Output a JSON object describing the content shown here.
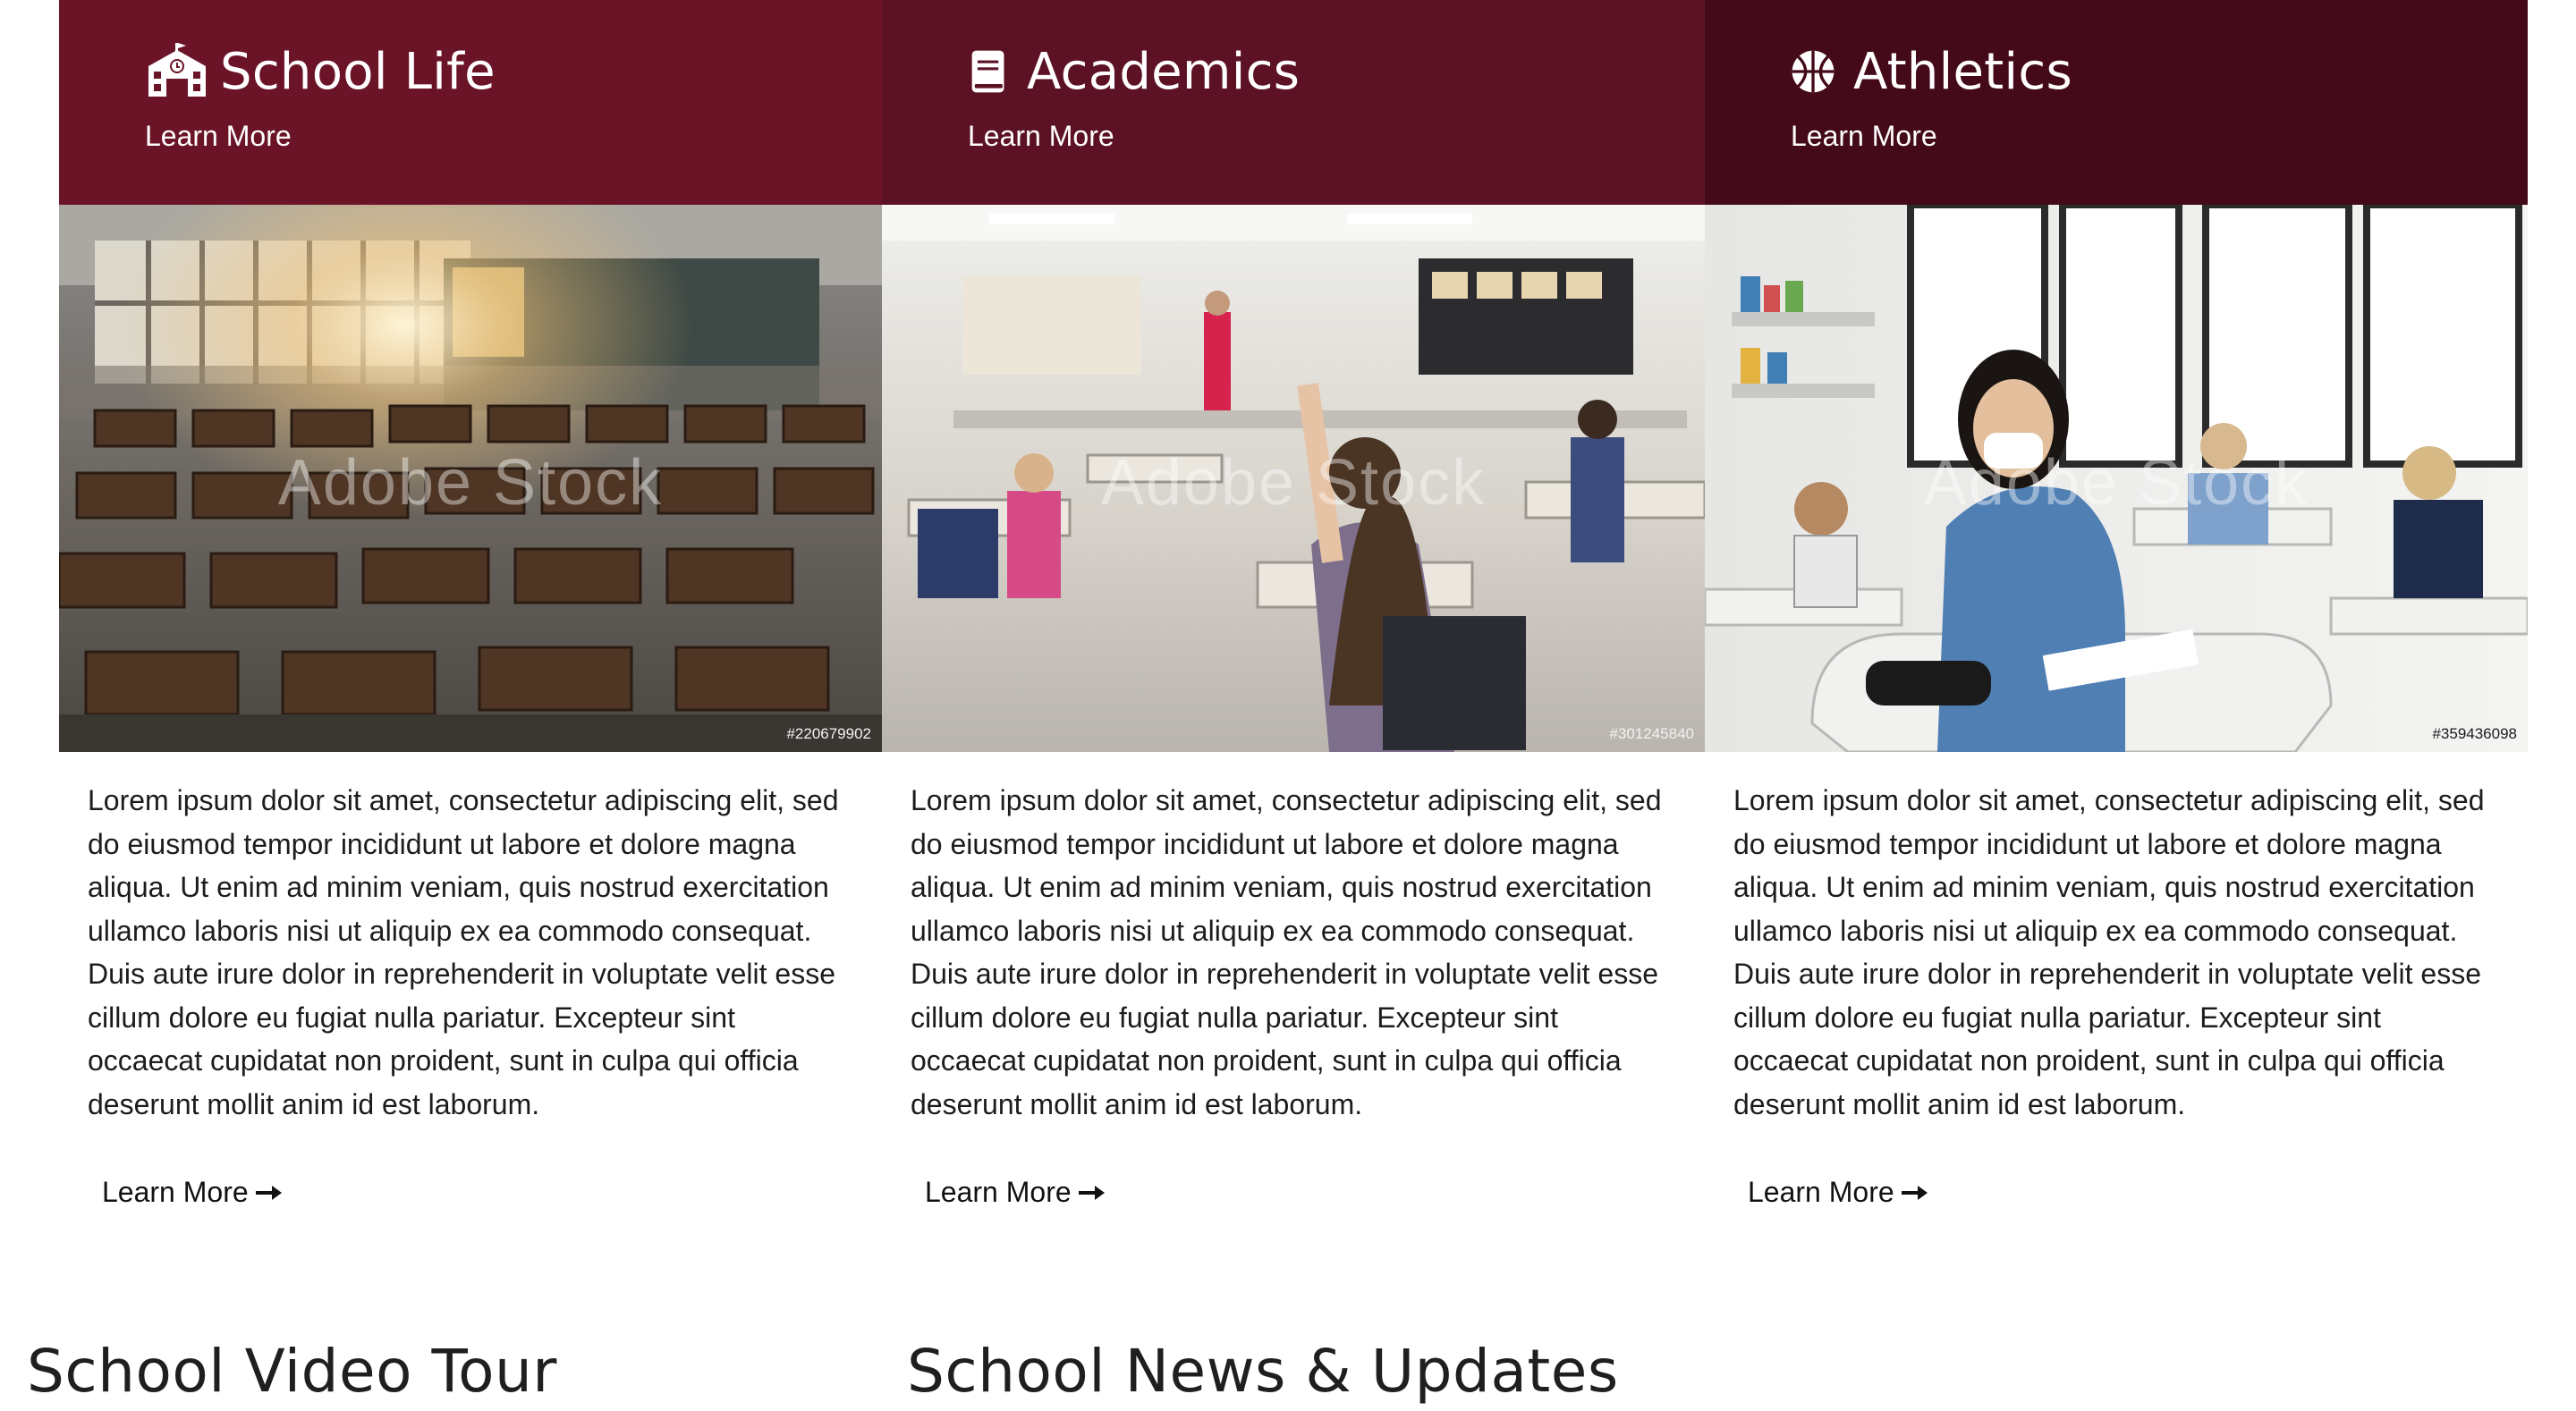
{
  "colors": {
    "card1_head": "#6b1428",
    "card2_head": "#5c1224",
    "card3_head": "#440a19"
  },
  "cards": [
    {
      "title": "School Life",
      "icon": "school-building-icon",
      "head_link": "Learn More",
      "image_id": "#220679902",
      "watermark": "Adobe Stock",
      "body": "Lorem ipsum dolor sit amet, consectetur adipiscing elit, sed do eiusmod tempor incididunt ut labore et dolore magna aliqua. Ut enim ad minim veniam, quis nostrud exercitation ullamco laboris nisi ut aliquip ex ea commodo consequat. Duis aute irure dolor in reprehenderit in voluptate velit esse cillum dolore eu fugiat nulla pariatur. Excepteur sint occaecat cupidatat non proident, sunt in culpa qui officia deserunt mollit anim id est laborum.",
      "more_link": "Learn More"
    },
    {
      "title": "Academics",
      "icon": "book-icon",
      "head_link": "Learn More",
      "image_id": "#301245840",
      "watermark": "Adobe Stock",
      "body": "Lorem ipsum dolor sit amet, consectetur adipiscing elit, sed do eiusmod tempor incididunt ut labore et dolore magna aliqua. Ut enim ad minim veniam, quis nostrud exercitation ullamco laboris nisi ut aliquip ex ea commodo consequat. Duis aute irure dolor in reprehenderit in voluptate velit esse cillum dolore eu fugiat nulla pariatur. Excepteur sint occaecat cupidatat non proident, sunt in culpa qui officia deserunt mollit anim id est laborum.",
      "more_link": "Learn More"
    },
    {
      "title": "Athletics",
      "icon": "basketball-icon",
      "head_link": "Learn More",
      "image_id": "#359436098",
      "watermark": "Adobe Stock",
      "body": "Lorem ipsum dolor sit amet, consectetur adipiscing elit, sed do eiusmod tempor incididunt ut labore et dolore magna aliqua. Ut enim ad minim veniam, quis nostrud exercitation ullamco laboris nisi ut aliquip ex ea commodo consequat. Duis aute irure dolor in reprehenderit in voluptate velit esse cillum dolore eu fugiat nulla pariatur. Excepteur sint occaecat cupidatat non proident, sunt in culpa qui officia deserunt mollit anim id est laborum.",
      "more_link": "Learn More"
    }
  ],
  "sections": {
    "video_tour": "School Video Tour",
    "news": "School News & Updates"
  }
}
